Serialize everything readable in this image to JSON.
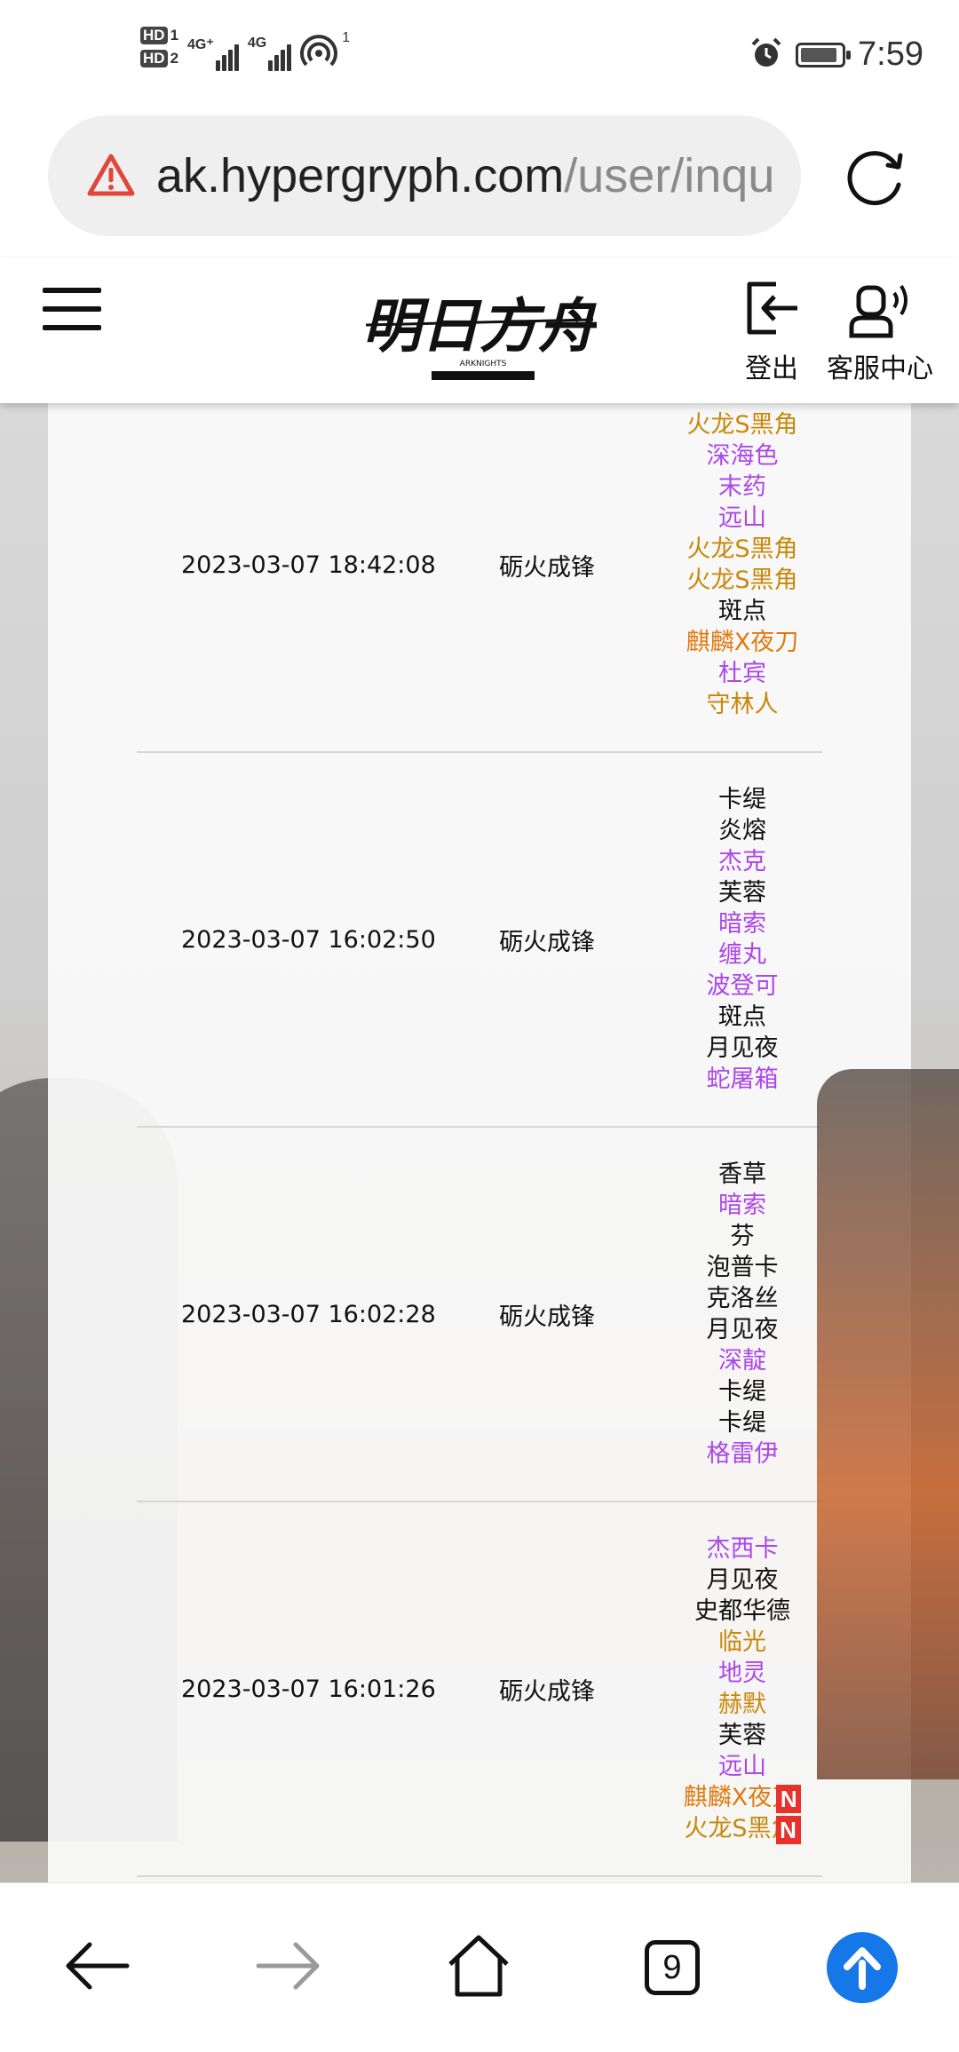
{
  "status_bar": {
    "sim1": "HD",
    "sim1_num": "1",
    "sim2": "HD",
    "sim2_num": "2",
    "network1": "4G⁺",
    "network2": "4G",
    "hotspot_count": "1",
    "time": "7:59",
    "battery_level_percent": 90
  },
  "address_bar": {
    "host": "ak.hypergryph.com",
    "path": "/user/inqu",
    "icon": "warning-icon"
  },
  "header": {
    "logo_text": "明日方舟",
    "logo_sub": "ARKNIGHTS",
    "logout_label": "登出",
    "service_label": "客服中心"
  },
  "records": [
    {
      "time": "2023-03-07 18:42:08",
      "pool": "砺火成锋",
      "operators": [
        {
          "name": "火龙S黑角",
          "rarity": 5
        },
        {
          "name": "深海色",
          "rarity": 4
        },
        {
          "name": "末药",
          "rarity": 4
        },
        {
          "name": "远山",
          "rarity": 4
        },
        {
          "name": "火龙S黑角",
          "rarity": 5
        },
        {
          "name": "火龙S黑角",
          "rarity": 5
        },
        {
          "name": "斑点",
          "rarity": 3
        },
        {
          "name": "麒麟X夜刀",
          "rarity": 6
        },
        {
          "name": "杜宾",
          "rarity": 4
        },
        {
          "name": "守林人",
          "rarity": 5
        }
      ]
    },
    {
      "time": "2023-03-07 16:02:50",
      "pool": "砺火成锋",
      "operators": [
        {
          "name": "卡缇",
          "rarity": 3
        },
        {
          "name": "炎熔",
          "rarity": 3
        },
        {
          "name": "杰克",
          "rarity": 4
        },
        {
          "name": "芙蓉",
          "rarity": 3
        },
        {
          "name": "暗索",
          "rarity": 4
        },
        {
          "name": "缠丸",
          "rarity": 4
        },
        {
          "name": "波登可",
          "rarity": 4
        },
        {
          "name": "斑点",
          "rarity": 3
        },
        {
          "name": "月见夜",
          "rarity": 3
        },
        {
          "name": "蛇屠箱",
          "rarity": 4
        }
      ]
    },
    {
      "time": "2023-03-07 16:02:28",
      "pool": "砺火成锋",
      "operators": [
        {
          "name": "香草",
          "rarity": 3
        },
        {
          "name": "暗索",
          "rarity": 4
        },
        {
          "name": "芬",
          "rarity": 3
        },
        {
          "name": "泡普卡",
          "rarity": 3
        },
        {
          "name": "克洛丝",
          "rarity": 3
        },
        {
          "name": "月见夜",
          "rarity": 3
        },
        {
          "name": "深靛",
          "rarity": 4
        },
        {
          "name": "卡缇",
          "rarity": 3
        },
        {
          "name": "卡缇",
          "rarity": 3
        },
        {
          "name": "格雷伊",
          "rarity": 4
        }
      ]
    },
    {
      "time": "2023-03-07 16:01:26",
      "pool": "砺火成锋",
      "operators": [
        {
          "name": "杰西卡",
          "rarity": 4
        },
        {
          "name": "月见夜",
          "rarity": 3
        },
        {
          "name": "史都华德",
          "rarity": 3
        },
        {
          "name": "临光",
          "rarity": 5
        },
        {
          "name": "地灵",
          "rarity": 4
        },
        {
          "name": "赫默",
          "rarity": 5
        },
        {
          "name": "芙蓉",
          "rarity": 3
        },
        {
          "name": "远山",
          "rarity": 4
        },
        {
          "name": "麒麟X夜刀",
          "rarity": 6,
          "new": "N"
        },
        {
          "name": "火龙S黑角",
          "rarity": 5,
          "new": "N"
        }
      ]
    }
  ],
  "rarity_colors": {
    "3": "#111111",
    "4": "#ac47e8",
    "5": "#c8880a",
    "6": "#e07a10"
  },
  "bottom_nav": {
    "back_icon": "arrow-left-icon",
    "forward_icon": "arrow-right-icon",
    "home_icon": "home-icon",
    "tabs_count": "9",
    "upload_icon": "arrow-up-icon",
    "accent": "#1677e8"
  }
}
